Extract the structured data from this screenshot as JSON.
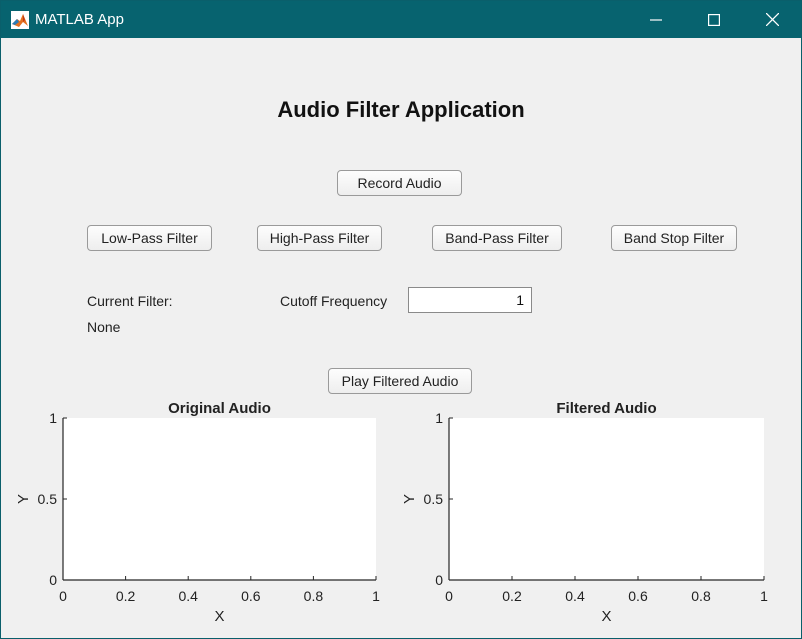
{
  "window": {
    "title": "MATLAB App",
    "controls": {
      "minimize": "minimize-icon",
      "maximize": "maximize-icon",
      "close": "close-icon"
    }
  },
  "app": {
    "title": "Audio Filter Application",
    "record_button": "Record Audio",
    "filter_buttons": [
      "Low-Pass Filter",
      "High-Pass Filter",
      "Band-Pass Filter",
      "Band Stop Filter"
    ],
    "current_filter_label": "Current Filter:",
    "current_filter_value": "None",
    "cutoff_label": "Cutoff Frequency",
    "cutoff_value": "1",
    "play_button": "Play Filtered Audio"
  },
  "chart_data": [
    {
      "type": "line",
      "title": "Original Audio",
      "xlabel": "X",
      "ylabel": "Y",
      "xlim": [
        0,
        1
      ],
      "ylim": [
        0,
        1
      ],
      "xticks": [
        "0",
        "0.2",
        "0.4",
        "0.6",
        "0.8",
        "1"
      ],
      "yticks": [
        "0",
        "0.5",
        "1"
      ],
      "series": [],
      "grid": false
    },
    {
      "type": "line",
      "title": "Filtered Audio",
      "xlabel": "X",
      "ylabel": "Y",
      "xlim": [
        0,
        1
      ],
      "ylim": [
        0,
        1
      ],
      "xticks": [
        "0",
        "0.2",
        "0.4",
        "0.6",
        "0.8",
        "1"
      ],
      "yticks": [
        "0",
        "0.5",
        "1"
      ],
      "series": [],
      "grid": false
    }
  ],
  "colors": {
    "titlebar": "#07636f",
    "background": "#f0f0f0",
    "axes_bg": "#ffffff"
  }
}
